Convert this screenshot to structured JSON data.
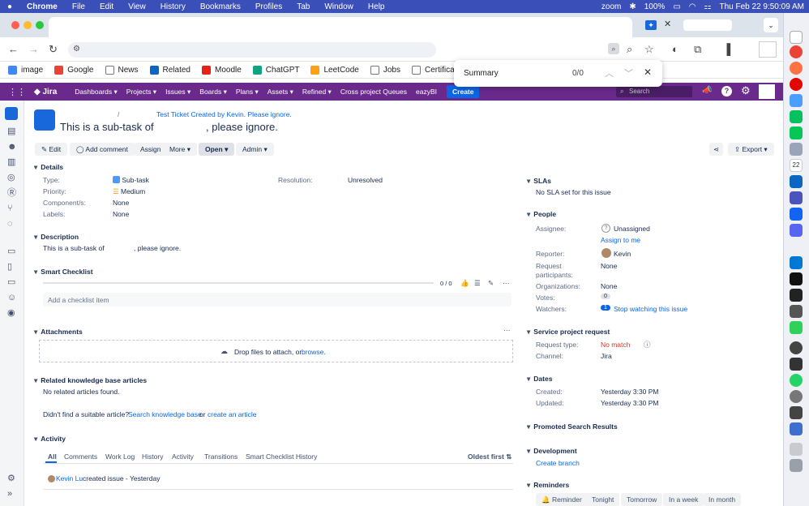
{
  "menubar": {
    "app": "Chrome",
    "items": [
      "File",
      "Edit",
      "View",
      "History",
      "Bookmarks",
      "Profiles",
      "Tab",
      "Window",
      "Help"
    ],
    "zoom": "zoom",
    "battery": "100%",
    "datetime": "Thu Feb 22  9:50:09 AM"
  },
  "bookmarks": [
    {
      "label": "image",
      "color": "#4285f4"
    },
    {
      "label": "Google",
      "color": "#ea4335"
    },
    {
      "label": "News",
      "color": "#777777"
    },
    {
      "label": "Related",
      "color": "#0a66c2"
    },
    {
      "label": "Moodle",
      "color": "#e62117"
    },
    {
      "label": "ChatGPT",
      "color": "#10a37f"
    },
    {
      "label": "LeetCode",
      "color": "#ffa116"
    },
    {
      "label": "Jobs",
      "color": "#777777"
    },
    {
      "label": "Certificates",
      "color": "#777777"
    }
  ],
  "find": {
    "query": "Summary",
    "count": "0/0"
  },
  "jira": {
    "logo": "Jira",
    "nav": [
      "Dashboards ▾",
      "Projects ▾",
      "Issues ▾",
      "Boards ▾",
      "Plans ▾",
      "Assets ▾",
      "Refined ▾",
      "Cross project Queues",
      "eazyBI"
    ],
    "create": "Create",
    "search_placeholder": "Search"
  },
  "issue": {
    "breadcrumb_sep": "/",
    "parent_link": "Test Ticket Created by Kevin. Please ignore.",
    "title_a": "This is a sub-task of",
    "title_b": ", please ignore."
  },
  "actions": {
    "edit": "Edit",
    "comment": "Add comment",
    "assign": "Assign",
    "more": "More ▾",
    "status": "Open ▾",
    "admin": "Admin ▾",
    "export": "Export ▾"
  },
  "details": {
    "heading": "Details",
    "type_label": "Type:",
    "type_value": "Sub-task",
    "priority_label": "Priority:",
    "priority_value": "Medium",
    "components_label": "Component/s:",
    "components_value": "None",
    "labels_label": "Labels:",
    "labels_value": "None",
    "resolution_label": "Resolution:",
    "resolution_value": "Unresolved"
  },
  "description": {
    "heading": "Description",
    "text_a": "This is a sub-task of",
    "text_b": ", please ignore."
  },
  "checklist": {
    "heading": "Smart Checklist",
    "progress": "0 / 0",
    "placeholder": "Add a checklist item"
  },
  "attachments": {
    "heading": "Attachments",
    "drop_text": "Drop files to attach, or",
    "browse": "browse."
  },
  "kb": {
    "heading": "Related knowledge base articles",
    "none": "No related articles found.",
    "prompt": "Didn't find a suitable article?",
    "search_link": "Search knowledge base",
    "or": "or",
    "create_link": "create an article"
  },
  "activity": {
    "heading": "Activity",
    "tabs": [
      "All",
      "Comments",
      "Work Log",
      "History",
      "Activity",
      "Transitions",
      "Smart Checklist History"
    ],
    "sort": "Oldest first ⇅",
    "entry_user": "Kevin Lu",
    "entry_text": "created issue - Yesterday"
  },
  "slas": {
    "heading": "SLAs",
    "text": "No SLA set for this issue"
  },
  "people": {
    "heading": "People",
    "assignee_label": "Assignee:",
    "assignee_value": "Unassigned",
    "assign_me": "Assign to me",
    "reporter_label": "Reporter:",
    "reporter_value": "Kevin",
    "participants_label": "Request participants:",
    "participants_value": "None",
    "orgs_label": "Organizations:",
    "orgs_value": "None",
    "votes_label": "Votes:",
    "votes_value": "0",
    "watchers_label": "Watchers:",
    "watchers_count": "1",
    "watchers_link": "Stop watching this issue"
  },
  "spr": {
    "heading": "Service project request",
    "type_label": "Request type:",
    "type_value": "No match",
    "channel_label": "Channel:",
    "channel_value": "Jira"
  },
  "dates": {
    "heading": "Dates",
    "created_label": "Created:",
    "created_value": "Yesterday 3:30 PM",
    "updated_label": "Updated:",
    "updated_value": "Yesterday 3:30 PM"
  },
  "promoted": {
    "heading": "Promoted Search Results"
  },
  "development": {
    "heading": "Development",
    "create_branch": "Create branch"
  },
  "reminders": {
    "heading": "Reminders",
    "chips": [
      "Reminder",
      "Tonight",
      "Tomorrow",
      "In a week",
      "In month"
    ]
  },
  "dock": {
    "calendar_day": "22"
  }
}
